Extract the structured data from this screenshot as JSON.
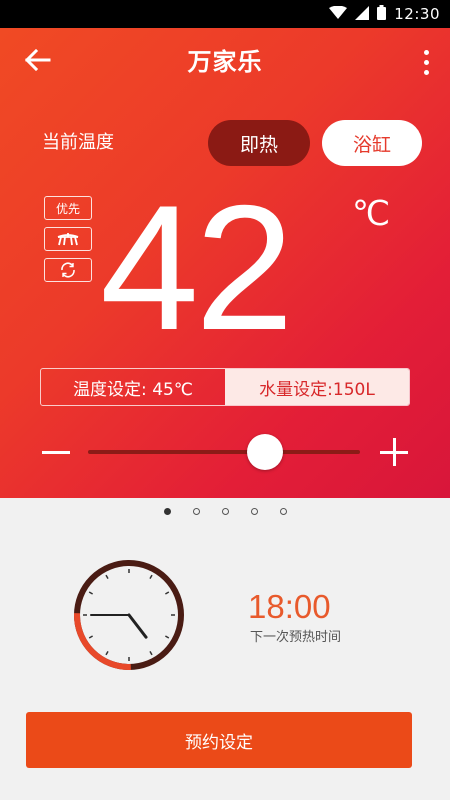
{
  "status_bar": {
    "time": "12:30",
    "icons": [
      "wifi-icon",
      "signal-icon",
      "battery-icon"
    ]
  },
  "header": {
    "title": "万家乐",
    "back_icon": "back-arrow-icon",
    "more_icon": "more-vert-icon"
  },
  "current_temp": {
    "label": "当前温度",
    "value": "42",
    "unit": "℃"
  },
  "modes": [
    {
      "label": "即热",
      "active": true
    },
    {
      "label": "浴缸",
      "active": false
    }
  ],
  "side_icons": [
    {
      "label": "优先",
      "icon": "priority-badge"
    },
    {
      "label": "",
      "icon": "shower-icon"
    },
    {
      "label": "",
      "icon": "cycle-icon"
    }
  ],
  "settings": {
    "temp_setting": "温度设定: 45℃",
    "water_setting": "水量设定:150L"
  },
  "slider": {
    "level": 0.65,
    "minus": "minus-icon",
    "plus": "plus-icon"
  },
  "pager": {
    "count": 5,
    "active_index": 0
  },
  "schedule": {
    "time": "18:00",
    "subtitle": "下一次预热时间",
    "clock_hour": 4,
    "clock_minute": 45
  },
  "reserve_button": {
    "label": "预约设定"
  },
  "colors": {
    "accent": "#eb4a18",
    "hero_start": "#f04a24",
    "hero_end": "#d8163a",
    "mode_active_bg": "#8b1a14",
    "schedule_time": "#e85a2c"
  }
}
